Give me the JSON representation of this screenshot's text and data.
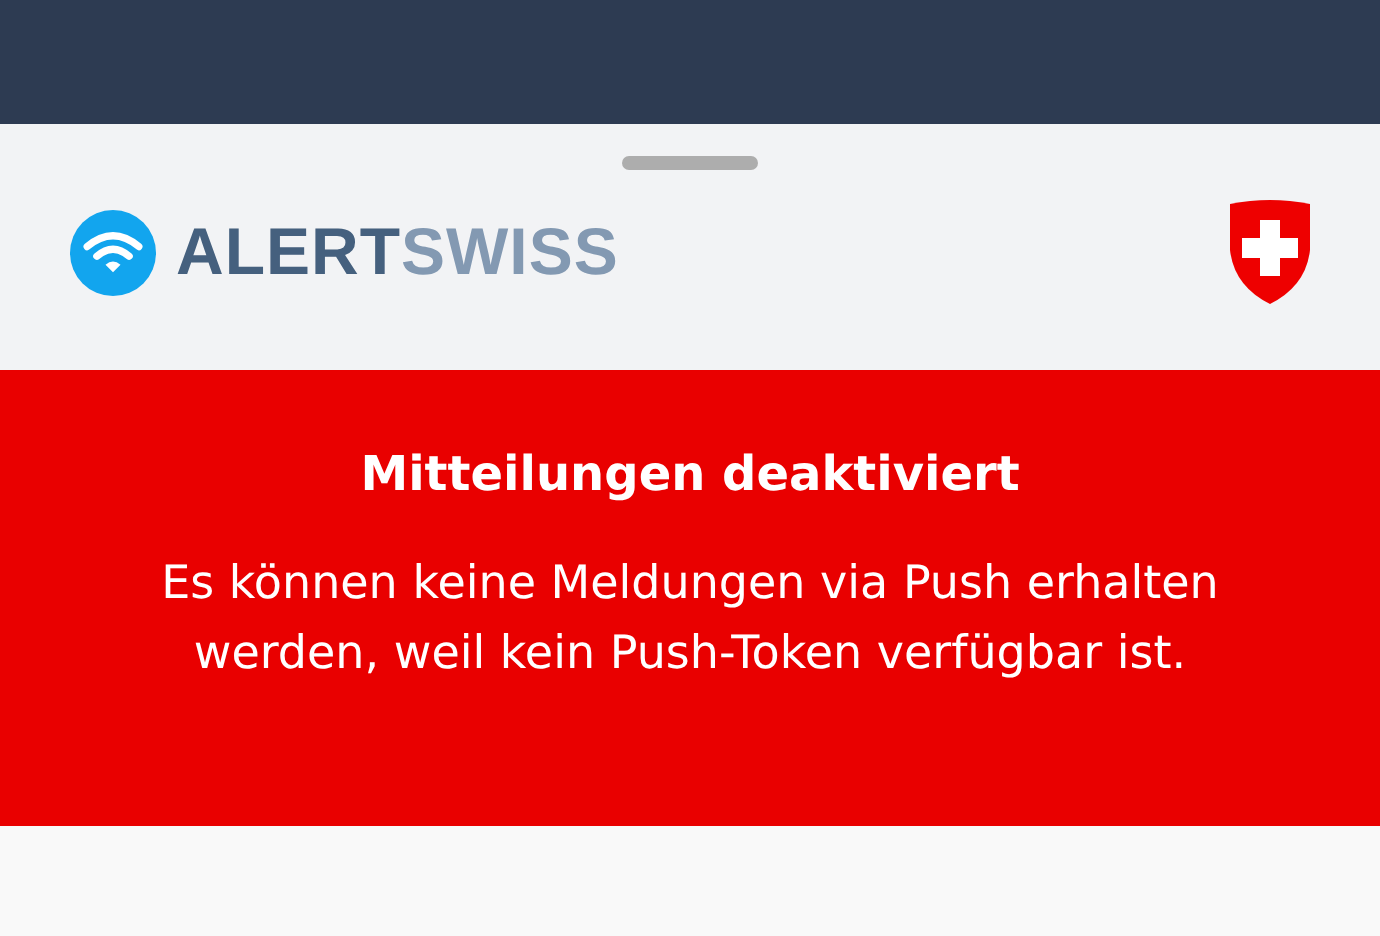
{
  "header": {
    "brand_primary": "ALERT",
    "brand_secondary": "SWISS"
  },
  "banner": {
    "title": "Mitteilungen deaktiviert",
    "message": "Es können keine Meldungen via Push erhalten werden, weil kein Push-Token verfügbar ist."
  }
}
